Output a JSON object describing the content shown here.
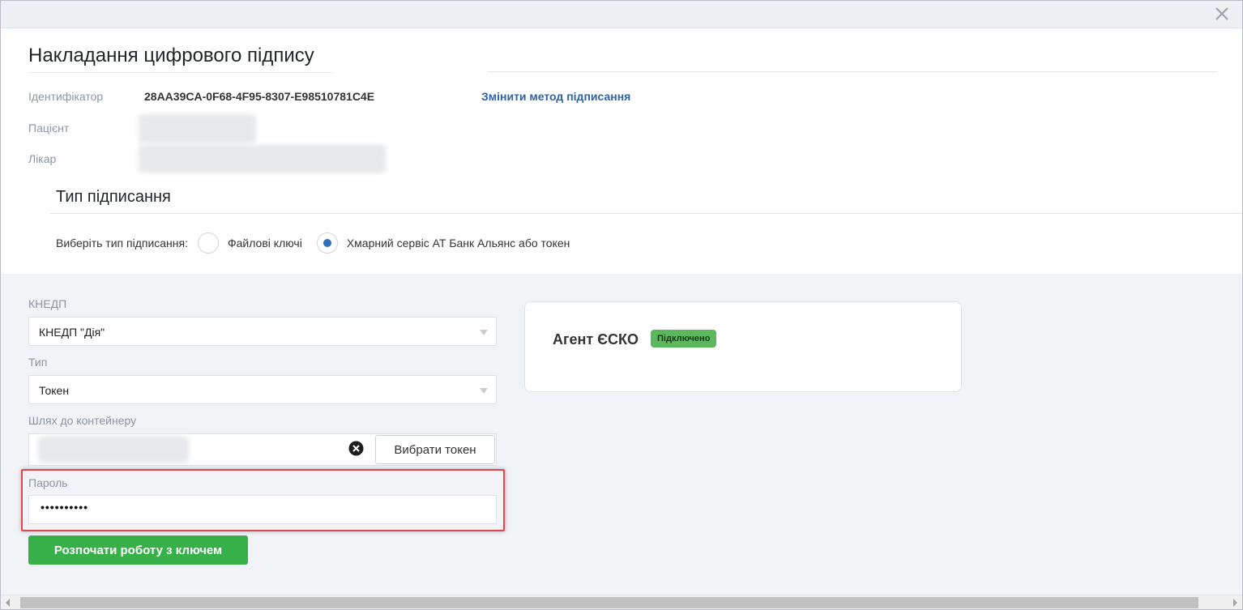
{
  "modal": {
    "title": "Накладання цифрового підпису",
    "close_icon": "close-icon"
  },
  "info": {
    "identifier_label": "Ідентифікатор",
    "identifier_value": "28AA39CA-0F68-4F95-8307-E98510781C4E",
    "change_method_link": "Змінити метод підписання",
    "patient_label": "Пацієнт",
    "doctor_label": "Лікар"
  },
  "signing_type": {
    "section_title": "Тип підписання",
    "prompt": "Виберіть тип підписання:",
    "options": [
      {
        "label": "Файлові ключі",
        "selected": false
      },
      {
        "label": "Хмарний сервіс АТ Банк Альянс або токен",
        "selected": true
      }
    ]
  },
  "form": {
    "kedp_label": "КНЕДП",
    "kedp_value": "КНЕДП \"Дія\"",
    "type_label": "Тип",
    "type_value": "Токен",
    "path_label": "Шлях до контейнеру",
    "choose_token_button": "Вибрати токен",
    "password_label": "Пароль",
    "password_value": "••••••••••",
    "start_button": "Розпочати роботу з ключем"
  },
  "agent": {
    "title": "Агент ЄСКО",
    "status": "Підключено"
  },
  "colors": {
    "accent_link": "#2e62a8",
    "primary_button": "#38b049",
    "status_badge": "#5cb85c",
    "highlight": "#e0474c",
    "radio_selected": "#2e6fb7"
  }
}
